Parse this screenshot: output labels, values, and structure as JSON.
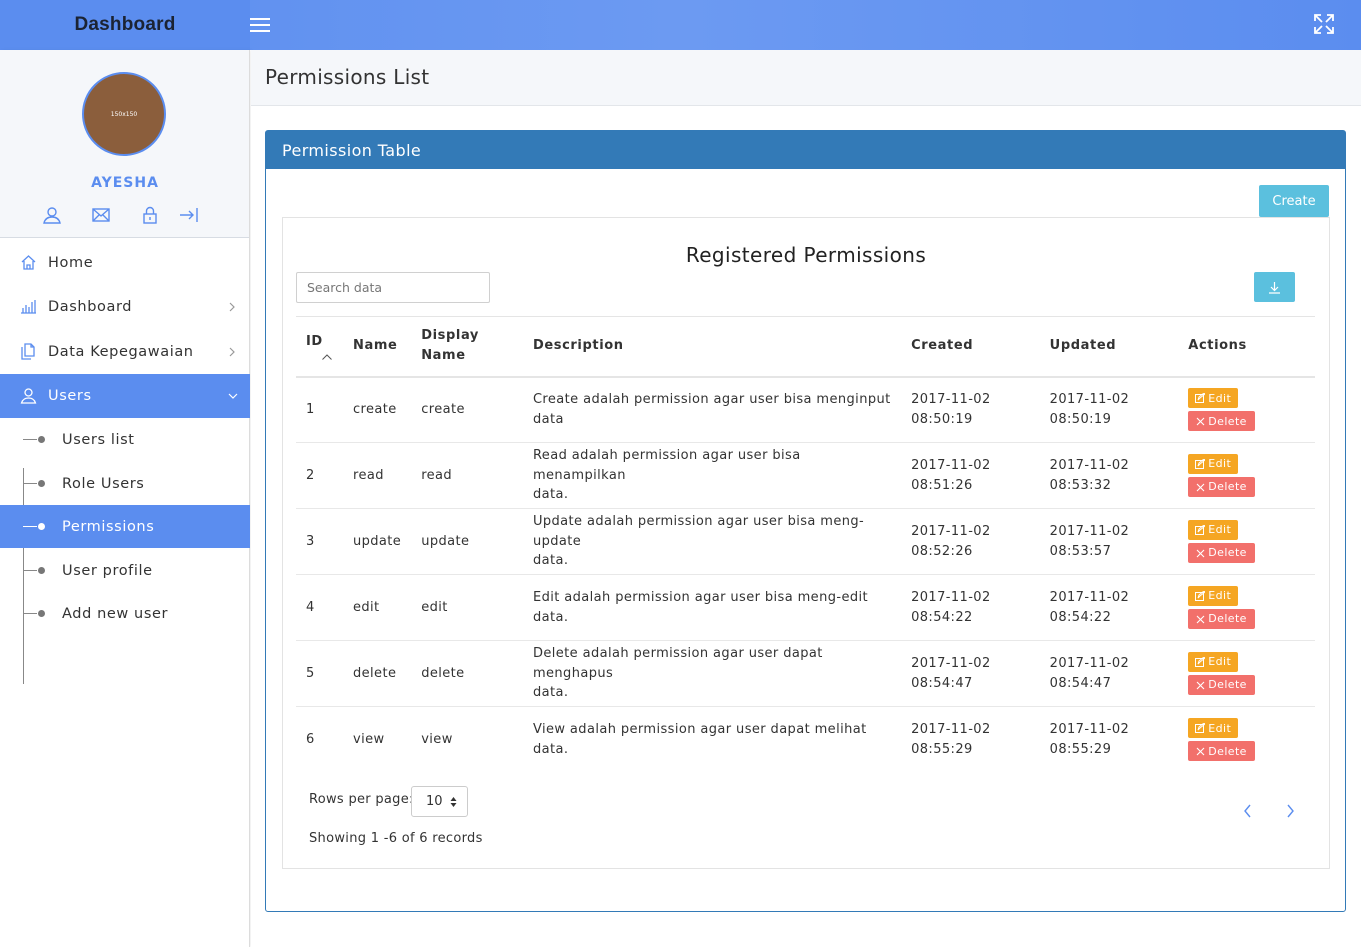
{
  "topbar": {
    "brand": "Dashboard"
  },
  "user": {
    "name": "AYESHA",
    "avatar_text": "150x150"
  },
  "sidebar": {
    "items": [
      {
        "label": "Home"
      },
      {
        "label": "Dashboard"
      },
      {
        "label": "Data Kepegawaian"
      },
      {
        "label": "Users"
      }
    ],
    "sub_items": [
      {
        "label": "Users list"
      },
      {
        "label": "Role Users"
      },
      {
        "label": "Permissions"
      },
      {
        "label": "User profile"
      },
      {
        "label": "Add new user"
      }
    ]
  },
  "page": {
    "title": "Permissions List"
  },
  "panel": {
    "title": "Permission Table",
    "create_label": "Create"
  },
  "card": {
    "title": "Registered Permissions",
    "search_placeholder": "Search data"
  },
  "table": {
    "headers": {
      "id": "ID",
      "name": "Name",
      "display_name_1": "Display",
      "display_name_2": "Name",
      "description": "Description",
      "created": "Created",
      "updated": "Updated",
      "actions": "Actions"
    },
    "edit_label": "Edit",
    "delete_label": "Delete",
    "rows": [
      {
        "id": "1",
        "name": "create",
        "display": "create",
        "desc1": "Create adalah permission agar user bisa menginput",
        "desc2": "data",
        "created_date": "2017-11-02",
        "created_time": "08:50:19",
        "updated_date": "2017-11-02",
        "updated_time": "08:50:19"
      },
      {
        "id": "2",
        "name": "read",
        "display": "read",
        "desc1": "Read adalah permission agar user bisa menampilkan",
        "desc2": "data.",
        "created_date": "2017-11-02",
        "created_time": "08:51:26",
        "updated_date": "2017-11-02",
        "updated_time": "08:53:32"
      },
      {
        "id": "3",
        "name": "update",
        "display": "update",
        "desc1": "Update adalah permission agar user bisa meng-update",
        "desc2": "data.",
        "created_date": "2017-11-02",
        "created_time": "08:52:26",
        "updated_date": "2017-11-02",
        "updated_time": "08:53:57"
      },
      {
        "id": "4",
        "name": "edit",
        "display": "edit",
        "desc1": "Edit adalah permission agar user bisa meng-edit data.",
        "desc2": "",
        "created_date": "2017-11-02",
        "created_time": "08:54:22",
        "updated_date": "2017-11-02",
        "updated_time": "08:54:22"
      },
      {
        "id": "5",
        "name": "delete",
        "display": "delete",
        "desc1": "Delete adalah permission agar user dapat menghapus",
        "desc2": "data.",
        "created_date": "2017-11-02",
        "created_time": "08:54:47",
        "updated_date": "2017-11-02",
        "updated_time": "08:54:47"
      },
      {
        "id": "6",
        "name": "view",
        "display": "view",
        "desc1": "View adalah permission agar user dapat melihat data.",
        "desc2": "",
        "created_date": "2017-11-02",
        "created_time": "08:55:29",
        "updated_date": "2017-11-02",
        "updated_time": "08:55:29"
      }
    ]
  },
  "pagination": {
    "rows_label": "Rows per page:",
    "rows_value": "10",
    "showing": "Showing 1 -6 of 6 records"
  },
  "colors": {
    "accent": "#5b8def",
    "panel": "#337ab7",
    "info": "#5bc0de",
    "edit": "#f5a623",
    "delete": "#f2706b"
  }
}
